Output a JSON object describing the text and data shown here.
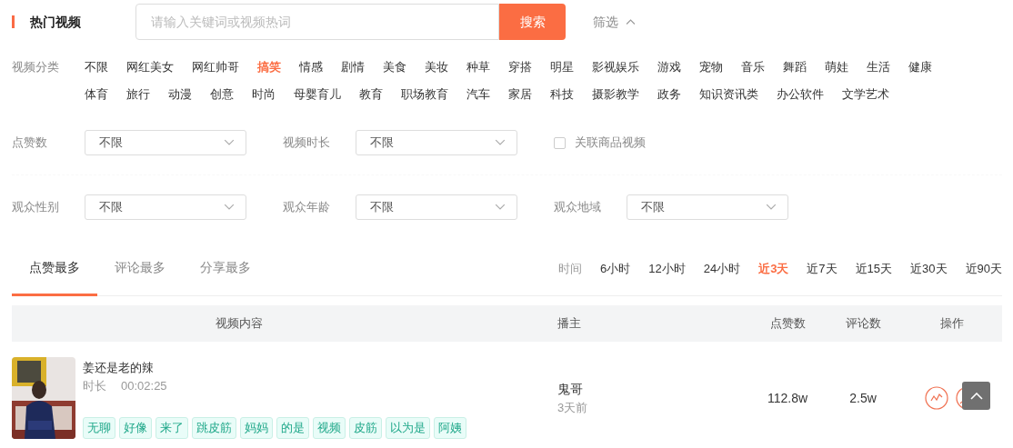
{
  "header": {
    "title": "热门视频",
    "search": {
      "placeholder": "请输入关键词或视频热词",
      "button": "搜索"
    },
    "filter_toggle": {
      "label": "筛选",
      "expanded": true
    }
  },
  "category": {
    "label": "视频分类",
    "items": [
      {
        "label": "不限",
        "selected": false
      },
      {
        "label": "网红美女",
        "selected": false
      },
      {
        "label": "网红帅哥",
        "selected": false
      },
      {
        "label": "搞笑",
        "selected": true
      },
      {
        "label": "情感",
        "selected": false
      },
      {
        "label": "剧情",
        "selected": false
      },
      {
        "label": "美食",
        "selected": false
      },
      {
        "label": "美妆",
        "selected": false
      },
      {
        "label": "种草",
        "selected": false
      },
      {
        "label": "穿搭",
        "selected": false
      },
      {
        "label": "明星",
        "selected": false
      },
      {
        "label": "影视娱乐",
        "selected": false
      },
      {
        "label": "游戏",
        "selected": false
      },
      {
        "label": "宠物",
        "selected": false
      },
      {
        "label": "音乐",
        "selected": false
      },
      {
        "label": "舞蹈",
        "selected": false
      },
      {
        "label": "萌娃",
        "selected": false
      },
      {
        "label": "生活",
        "selected": false
      },
      {
        "label": "健康",
        "selected": false
      },
      {
        "label": "体育",
        "selected": false
      },
      {
        "label": "旅行",
        "selected": false
      },
      {
        "label": "动漫",
        "selected": false
      },
      {
        "label": "创意",
        "selected": false
      },
      {
        "label": "时尚",
        "selected": false
      },
      {
        "label": "母婴育儿",
        "selected": false
      },
      {
        "label": "教育",
        "selected": false
      },
      {
        "label": "职场教育",
        "selected": false
      },
      {
        "label": "汽车",
        "selected": false
      },
      {
        "label": "家居",
        "selected": false
      },
      {
        "label": "科技",
        "selected": false
      },
      {
        "label": "摄影教学",
        "selected": false
      },
      {
        "label": "政务",
        "selected": false
      },
      {
        "label": "知识资讯类",
        "selected": false
      },
      {
        "label": "办公软件",
        "selected": false
      },
      {
        "label": "文学艺术",
        "selected": false
      }
    ]
  },
  "filter_rows": [
    [
      {
        "kind": "select",
        "label": "点赞数",
        "value": "不限"
      },
      {
        "kind": "select",
        "label": "视频时长",
        "value": "不限"
      },
      {
        "kind": "checkbox",
        "label": "关联商品视频",
        "checked": false
      }
    ],
    [
      {
        "kind": "select",
        "label": "观众性别",
        "value": "不限"
      },
      {
        "kind": "select",
        "label": "观众年龄",
        "value": "不限"
      },
      {
        "kind": "select",
        "label": "观众地域",
        "value": "不限"
      }
    ]
  ],
  "sort_tabs": [
    {
      "label": "点赞最多",
      "selected": true
    },
    {
      "label": "评论最多",
      "selected": false
    },
    {
      "label": "分享最多",
      "selected": false
    }
  ],
  "time_filter": {
    "label": "时间",
    "options": [
      {
        "label": "6小时",
        "selected": false
      },
      {
        "label": "12小时",
        "selected": false
      },
      {
        "label": "24小时",
        "selected": false
      },
      {
        "label": "近3天",
        "selected": true
      },
      {
        "label": "近7天",
        "selected": false
      },
      {
        "label": "近15天",
        "selected": false
      },
      {
        "label": "近30天",
        "selected": false
      },
      {
        "label": "近90天",
        "selected": false
      }
    ]
  },
  "table": {
    "columns": [
      "视频内容",
      "播主",
      "点赞数",
      "评论数",
      "操作"
    ],
    "rows": [
      {
        "title": "姜还是老的辣",
        "duration_label": "时长",
        "duration": "00:02:25",
        "tags": [
          "无聊",
          "好像",
          "来了",
          "跳皮筋",
          "妈妈",
          "的是",
          "视频",
          "皮筋",
          "以为是",
          "阿姨"
        ],
        "author": "鬼哥",
        "posted": "3天前",
        "likes": "112.8w",
        "comments": "2.5w"
      }
    ]
  }
}
